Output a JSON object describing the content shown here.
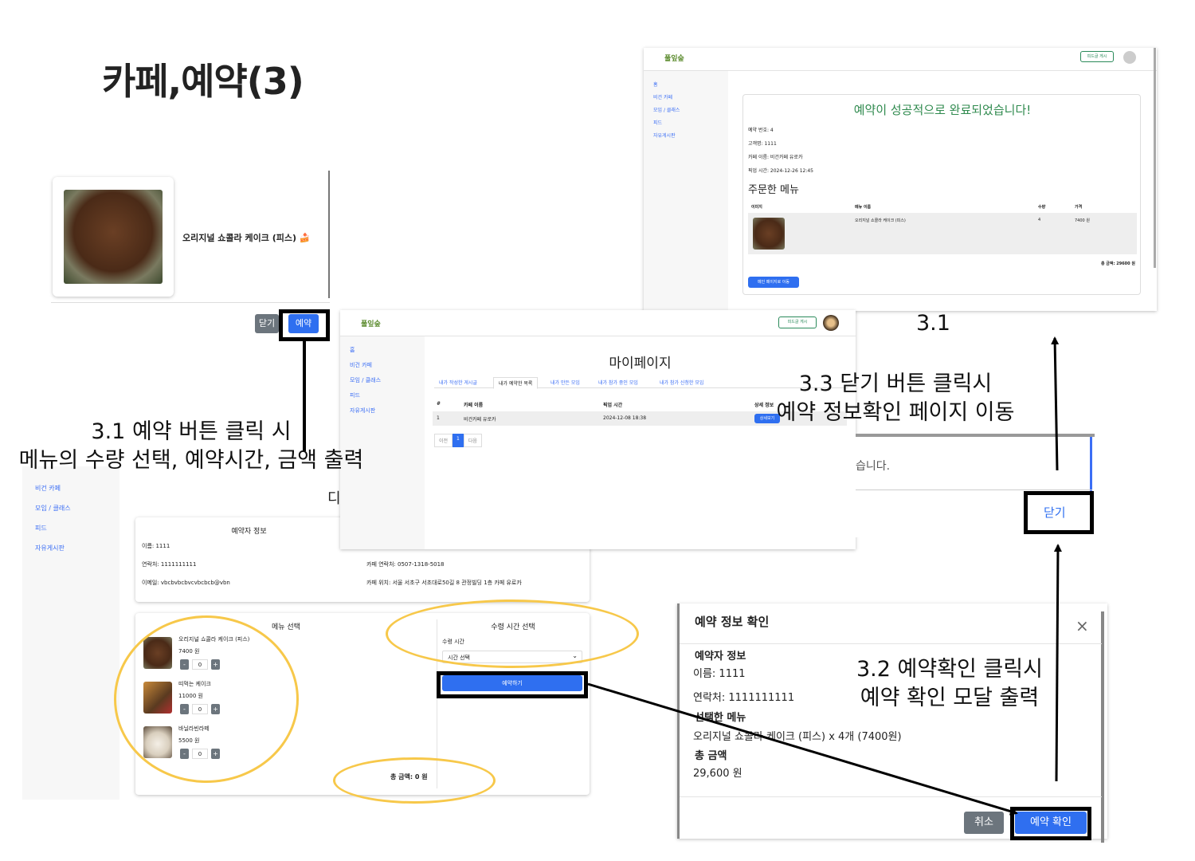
{
  "slide_title": "카페,예약(3)",
  "app": {
    "logo": "풀잎숲",
    "write_feed_button": "피드글 게시",
    "nav": [
      "홈",
      "비건 카페",
      "모임 / 클래스",
      "피드",
      "자유게시판"
    ]
  },
  "menu_modal_card": {
    "item_name": "오리지널 쇼콜라 케이크 (피스) 🍰",
    "close_button": "닫기",
    "reserve_button": "예약"
  },
  "reservation_done": {
    "heading": "예약이 성공적으로 완료되었습니다!",
    "reservation_no": "예약 번호: 4",
    "customer": "고객명: 1111",
    "cafe_name": "카페 이름: 비건카페 유로카",
    "pickup_time": "픽업 시간: 2024-12-26 12:45",
    "ordered_menu_title": "주문한 메뉴",
    "columns": [
      "이미지",
      "메뉴 이름",
      "수량",
      "가격"
    ],
    "row": {
      "name": "오리지널 쇼콜라 케이크 (피스)",
      "qty": "4",
      "price": "7400 원"
    },
    "total": "총 금액: 29600 원",
    "mypage_button": "메인 페이지로 이동"
  },
  "mypage": {
    "title": "마이페이지",
    "tabs": [
      "내가 작성한 게시글",
      "내가 예약한 목록",
      "내가 만든 모임",
      "내가 참가 중인 모임",
      "내가 참가 신청한 모임"
    ],
    "columns": [
      "#",
      "카페 이름",
      "픽업 시간",
      "상세 정보"
    ],
    "row": {
      "no": "1",
      "cafe": "비건카페 유로카",
      "time": "2024-12-08 18:38",
      "detail": "상세보기"
    },
    "pagination": {
      "prev": "이전",
      "page": "1",
      "next": "다음"
    }
  },
  "close_popup": {
    "partial_text": "습니다.",
    "close_button": "닫기"
  },
  "reserve_form": {
    "partial_heading": "디",
    "reserver_title": "예약자 정보",
    "name": "이름: 1111",
    "phone": "연락처: 1111111111",
    "email": "이메일: vbcbvbcbvcvbcbcb@vbn",
    "cafe_phone": "카페 연락처: 0507-1318-5018",
    "cafe_location": "카페 위치: 서울 서초구 서초대로50길 8 관정빌딩 1층 카페 유로카",
    "menu_select_title": "메뉴 선택",
    "pickup_select_title": "수령 시간 선택",
    "pickup_label": "수령 시간",
    "time_select_placeholder": "시간 선택",
    "reserve_button": "예약하기",
    "items": [
      {
        "name": "오리지널 쇼콜라 케이크 (피스)",
        "price": "7400 원",
        "qty": "0"
      },
      {
        "name": "띠먹는 케이크",
        "price": "11000 원",
        "qty": "0"
      },
      {
        "name": "바닐라빈라떼",
        "price": "5500 원",
        "qty": "0"
      }
    ],
    "total": "총 금액: 0 원"
  },
  "confirm_modal": {
    "title": "예약 정보 확인",
    "reserver_title": "예약자 정보",
    "name": "이름: 1111",
    "phone": "연락처: 1111111111",
    "selected_menu_title": "선택한 메뉴",
    "selected_menu": "오리지널 쇼콜라 케이크 (피스) x 4개 (7400원)",
    "total_title": "총 금액",
    "total": "29,600 원",
    "cancel_button": "취소",
    "confirm_button": "예약 확인"
  },
  "annotations": {
    "a31_line1": "3.1 예약 버튼 클릭 시",
    "a31_line2": "메뉴의 수량 선택, 예약시간, 금액 출력",
    "a31_label": "3.1",
    "a32_line1": "3.2  예약확인 클릭시",
    "a32_line2": "예약 확인 모달 출력",
    "a33_line1": "3.3 닫기 버튼 클릭시",
    "a33_line2": "예약 정보확인 페이지 이동"
  }
}
